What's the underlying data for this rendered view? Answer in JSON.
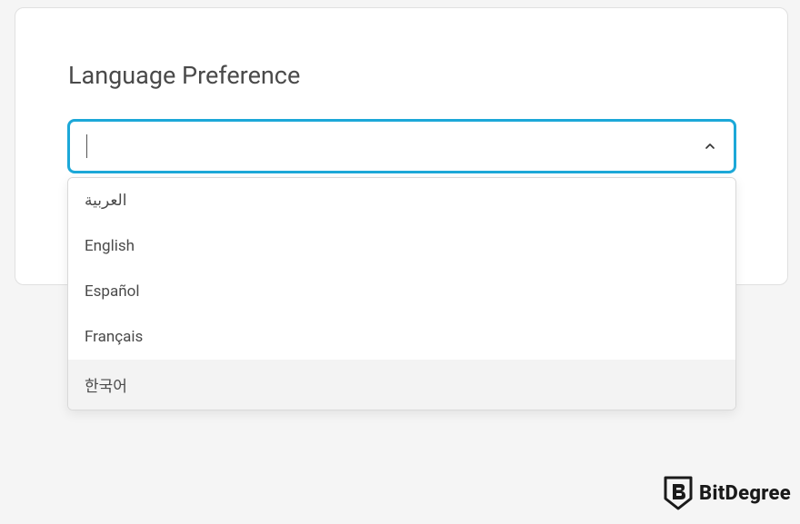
{
  "section": {
    "title": "Language Preference"
  },
  "select": {
    "value": "",
    "placeholder": ""
  },
  "options": [
    {
      "label": "العربية",
      "highlight": false
    },
    {
      "label": "English",
      "highlight": false
    },
    {
      "label": "Español",
      "highlight": false
    },
    {
      "label": "Français",
      "highlight": false
    },
    {
      "label": "한국어",
      "highlight": true
    }
  ],
  "brand": {
    "name": "BitDegree"
  },
  "colors": {
    "accent": "#1ca8d8",
    "text": "#4a4a4a",
    "highlight_bg": "#f3f3f3"
  }
}
